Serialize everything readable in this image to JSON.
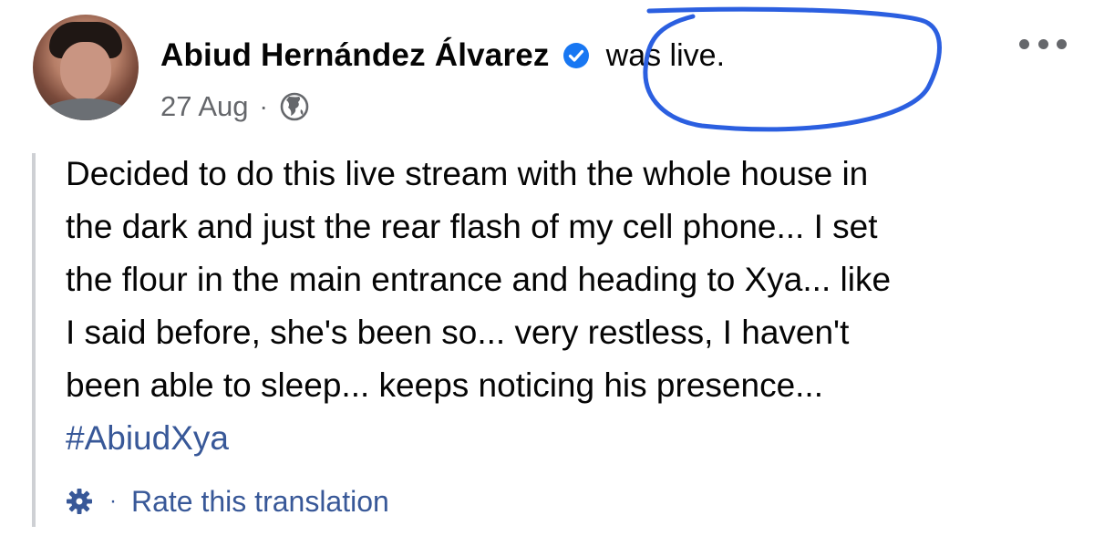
{
  "post": {
    "author": "Abiud Hernández Álvarez",
    "verified_icon": "verified-badge-icon",
    "status_text": "was live.",
    "date": "27 Aug",
    "meta_separator": "·",
    "privacy_icon": "globe-icon",
    "more_icon": "more-options-icon",
    "annotation_color": "#2b5fe0",
    "body_lines": [
      "Decided to do this live stream with the whole house in",
      "the dark and just the rear flash of my cell phone... I set",
      "the flour in the main entrance and heading to Xya... like",
      "I said before, she's been so... very restless, I haven't",
      "been able to sleep... keeps noticing his presence..."
    ],
    "hashtag": "#AbiudXya",
    "translation": {
      "icon": "gear-icon",
      "separator": "·",
      "label": "Rate this translation"
    }
  },
  "colors": {
    "link": "#385898",
    "verified": "#1877f2",
    "secondary_text": "#65676b"
  }
}
